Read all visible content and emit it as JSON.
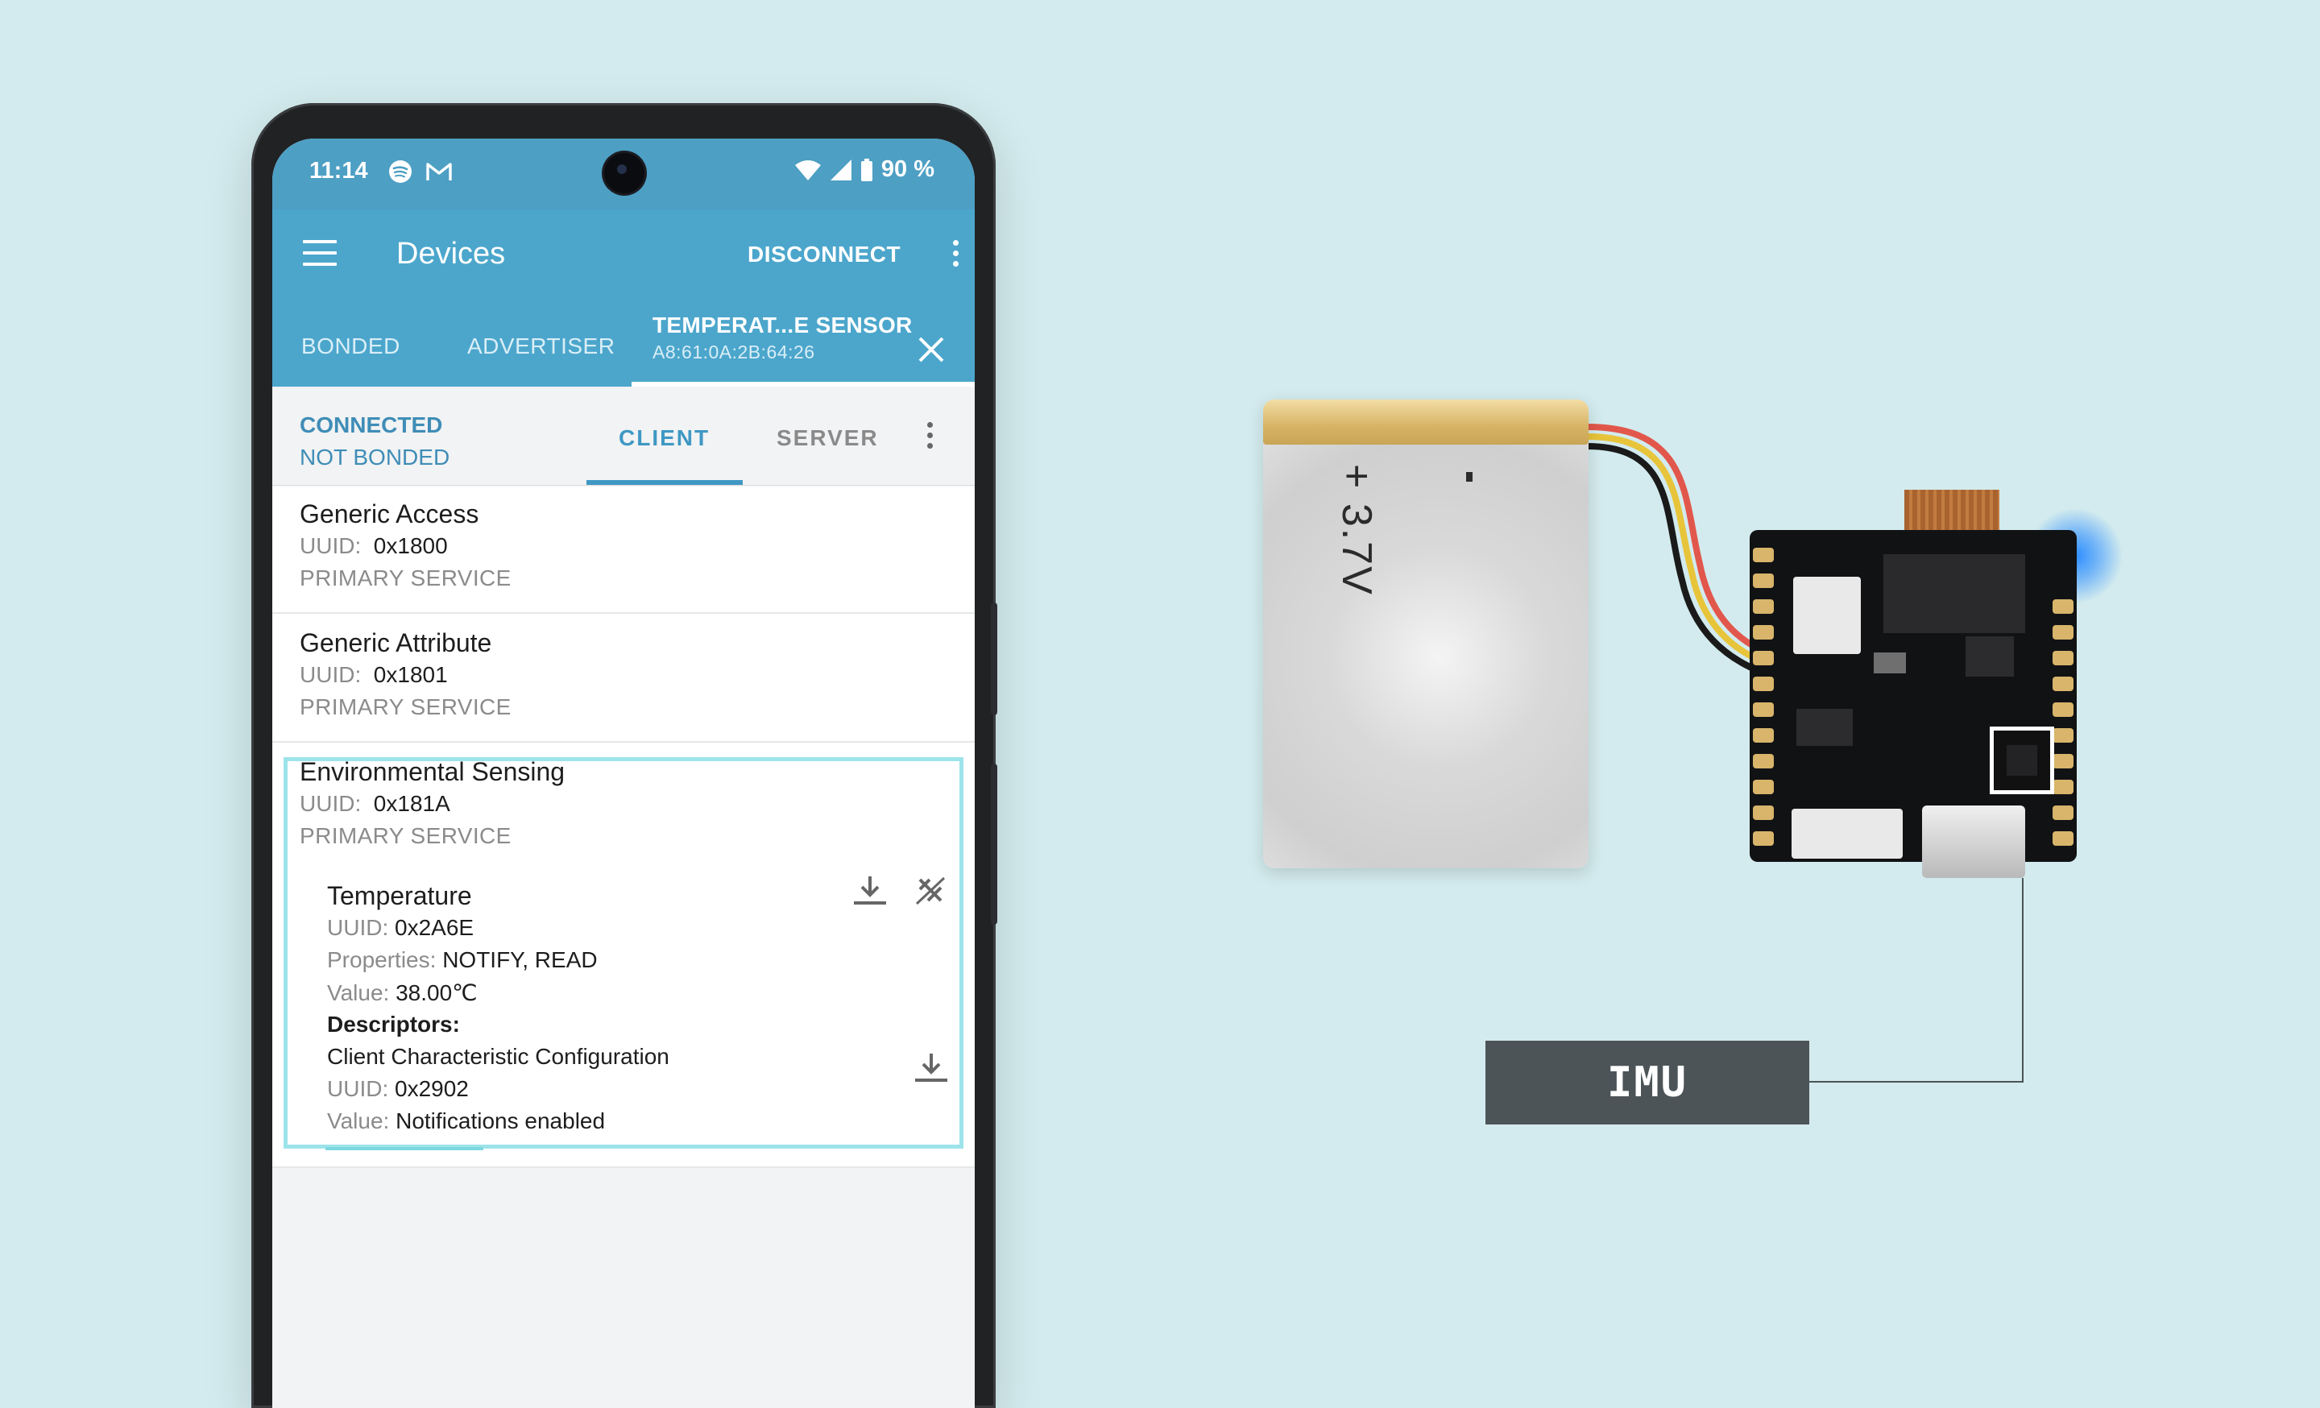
{
  "status_bar": {
    "time": "11:14",
    "battery": "90 %"
  },
  "app_bar": {
    "title": "Devices",
    "disconnect_label": "DISCONNECT"
  },
  "device_tabs": [
    {
      "label": "BONDED"
    },
    {
      "label": "ADVERTISER"
    },
    {
      "label": "TEMPERAT...E SENSOR",
      "sub": "A8:61:0A:2B:64:26",
      "active": true
    }
  ],
  "connection": {
    "state": "CONNECTED",
    "bond": "NOT BONDED"
  },
  "sub_tabs": [
    {
      "label": "CLIENT",
      "active": true
    },
    {
      "label": "SERVER"
    }
  ],
  "services": [
    {
      "name": "Generic Access",
      "uuid_label": "UUID:",
      "uuid": "0x1800",
      "type": "PRIMARY SERVICE"
    },
    {
      "name": "Generic Attribute",
      "uuid_label": "UUID:",
      "uuid": "0x1801",
      "type": "PRIMARY SERVICE"
    },
    {
      "name": "Environmental Sensing",
      "uuid_label": "UUID:",
      "uuid": "0x181A",
      "type": "PRIMARY SERVICE"
    }
  ],
  "characteristic": {
    "name": "Temperature",
    "uuid_label": "UUID:",
    "uuid": "0x2A6E",
    "properties_label": "Properties:",
    "properties": "NOTIFY, READ",
    "value_label": "Value:",
    "value": "38.00℃",
    "descriptors_label": "Descriptors:",
    "descriptor_name": "Client Characteristic Configuration",
    "descriptor_uuid_label": "UUID:",
    "descriptor_uuid": "0x2902",
    "descriptor_value_label": "Value:",
    "descriptor_value": "Notifications enabled"
  },
  "hardware": {
    "battery_label": "+ 3.7V",
    "battery_minus": "-",
    "imu_label": "IMU"
  },
  "colors": {
    "background": "#d3ebee",
    "app_bar": "#4ca6cc",
    "status_bar": "#4d9fc4",
    "accent_text": "#3f8db7",
    "highlight": "#9de4ea",
    "imu_label_bg": "#4c5458"
  },
  "icons": [
    "menu-icon",
    "more-vert-icon",
    "close-icon",
    "wifi-icon",
    "signal-icon",
    "battery-icon",
    "spotify-icon",
    "gmail-icon",
    "download-icon",
    "notifications-off-icon"
  ]
}
